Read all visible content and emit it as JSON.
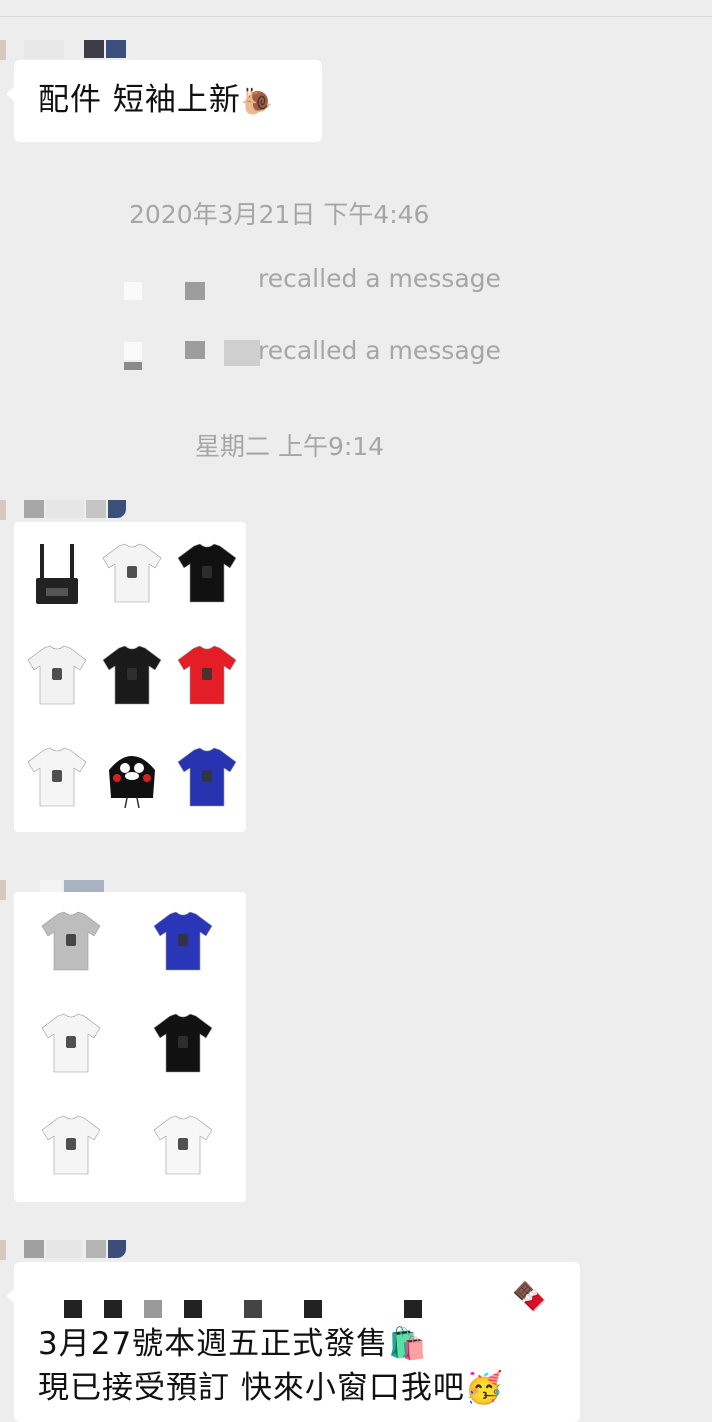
{
  "messages": [
    {
      "type": "text",
      "text": "配件 短袖上新",
      "emoji": "🐌"
    },
    {
      "type": "timestamp",
      "text": "2020年3月21日 下午4:46"
    },
    {
      "type": "recall",
      "text": "recalled a message"
    },
    {
      "type": "recall",
      "text": "recalled a message"
    },
    {
      "type": "timestamp",
      "text": "星期二 上午9:14"
    },
    {
      "type": "image",
      "items": [
        {
          "icon": "overall-icon",
          "color": "#222222"
        },
        {
          "icon": "tshirt-icon",
          "color": "#f4f4f4"
        },
        {
          "icon": "tshirt-icon",
          "color": "#111111"
        },
        {
          "icon": "tshirt-icon",
          "color": "#f2f2f2"
        },
        {
          "icon": "tshirt-icon",
          "color": "#1a1a1a"
        },
        {
          "icon": "tshirt-icon",
          "color": "#e41e26"
        },
        {
          "icon": "tshirt-icon",
          "color": "#f5f5f5"
        },
        {
          "icon": "hoodie-icon",
          "color": "#101010"
        },
        {
          "icon": "tshirt-icon",
          "color": "#2733b0"
        }
      ]
    },
    {
      "type": "image",
      "items": [
        {
          "icon": "tshirt-icon",
          "color": "#bdbdbd"
        },
        {
          "icon": "tshirt-icon",
          "color": "#2a36b8"
        },
        {
          "icon": "tshirt-icon",
          "color": "#f5f5f5"
        },
        {
          "icon": "tshirt-icon",
          "color": "#111111"
        },
        {
          "icon": "tshirt-icon",
          "color": "#f5f5f5"
        },
        {
          "icon": "tshirt-icon",
          "color": "#f7f7f7"
        }
      ]
    },
    {
      "type": "text",
      "line1": "3月27號本週五正式發售",
      "line1_emoji": "🛍️",
      "line2": "現已接受預訂 快來小窗口我吧",
      "line2_emoji": "🥳",
      "top_emoji": "🍫"
    }
  ]
}
